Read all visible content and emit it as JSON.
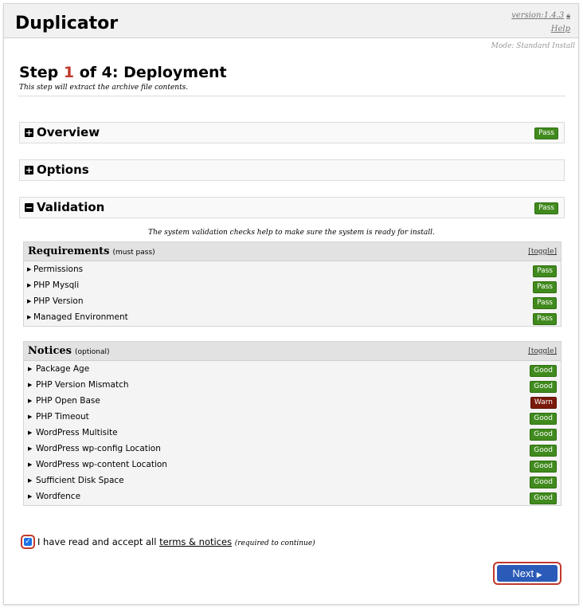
{
  "header": {
    "brand": "Duplicator",
    "version": "version:1.4.3",
    "help": "Help",
    "mode": "Mode: Standard Install"
  },
  "step": {
    "prefix": "Step ",
    "number": "1",
    "suffix": " of 4: Deployment",
    "subtitle": "This step will extract the archive file contents."
  },
  "sections": {
    "overview": {
      "title": "Overview",
      "badge": "Pass"
    },
    "options": {
      "title": "Options"
    },
    "validation": {
      "title": "Validation",
      "badge": "Pass",
      "note": "The system validation checks help to make sure the system is ready for install."
    }
  },
  "requirements": {
    "title": "Requirements",
    "hint": "(must pass)",
    "toggle": "[toggle]",
    "items": [
      {
        "label": "Permissions",
        "status": "Pass"
      },
      {
        "label": "PHP Mysqli",
        "status": "Pass"
      },
      {
        "label": "PHP Version",
        "status": "Pass"
      },
      {
        "label": "Managed Environment",
        "status": "Pass"
      }
    ]
  },
  "notices": {
    "title": "Notices",
    "hint": "(optional)",
    "toggle": "[toggle]",
    "items": [
      {
        "label": "Package Age",
        "status": "Good"
      },
      {
        "label": "PHP Version Mismatch",
        "status": "Good"
      },
      {
        "label": "PHP Open Base",
        "status": "Warn"
      },
      {
        "label": "PHP Timeout",
        "status": "Good"
      },
      {
        "label": "WordPress Multisite",
        "status": "Good"
      },
      {
        "label": "WordPress wp-config Location",
        "status": "Good"
      },
      {
        "label": "WordPress wp-content Location",
        "status": "Good"
      },
      {
        "label": "Sufficient Disk Space",
        "status": "Good"
      },
      {
        "label": "Wordfence",
        "status": "Good"
      }
    ]
  },
  "accept": {
    "checked": true,
    "text_before": "I have read and accept all ",
    "terms_link": "terms & notices",
    "required": "(required to continue)"
  },
  "next_button": {
    "label": "Next"
  },
  "colors": {
    "pass": "#418a1e",
    "warn": "#7a1a0c",
    "accent_red": "#c0392b",
    "button_blue": "#2b5bb8"
  }
}
